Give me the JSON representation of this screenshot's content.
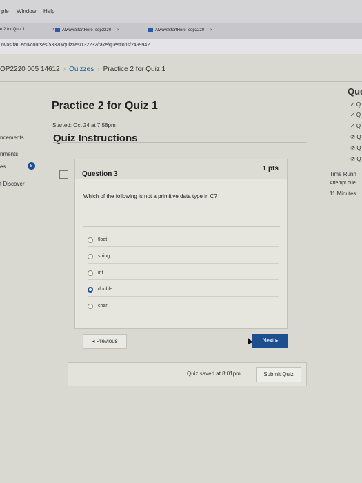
{
  "menubar": {
    "items": [
      "ple",
      "Window",
      "Help"
    ]
  },
  "tabs": [
    {
      "label": "e 2 for Quiz 1",
      "close": "×"
    },
    {
      "label": "AlwaysStartHere_cop2220 -",
      "close": "×"
    },
    {
      "label": "AlwaysStartHere_cop2220 -",
      "close": "×"
    }
  ],
  "url": "nvas.fau.edu/courses/53370/quizzes/132232/take/questions/2499942",
  "breadcrumb": {
    "course": "OP2220 005 14612",
    "quizzes": "Quizzes",
    "current": "Practice 2 for Quiz 1",
    "sep": "›"
  },
  "leftnav": {
    "items": [
      "ncements",
      "nments",
      "es",
      "t Discover"
    ],
    "badge": "8"
  },
  "quiz": {
    "title": "Practice 2 for Quiz 1",
    "started": "Started: Oct 24 at 7:58pm",
    "instructions_heading": "Quiz Instructions"
  },
  "question": {
    "number": "Question 3",
    "points": "1 pts",
    "text_before": "Which of the following is ",
    "text_underlined": "not a primitive data type",
    "text_after": " in C?",
    "answers": [
      {
        "label": "float",
        "selected": false
      },
      {
        "label": "string",
        "selected": false
      },
      {
        "label": "int",
        "selected": false
      },
      {
        "label": "double",
        "selected": true
      },
      {
        "label": "char",
        "selected": false
      }
    ]
  },
  "nav": {
    "previous": "◂ Previous",
    "next": "Next ▸"
  },
  "save": {
    "status": "Quiz saved at 8:01pm",
    "submit": "Submit Quiz"
  },
  "sidebar_right": {
    "heading": "Questi",
    "items": [
      "✓ Q",
      "✓ Q",
      "✓ Q",
      "⑦ Q",
      "⑦ Q",
      "⑦ Q"
    ]
  },
  "timer": {
    "label": "Time Runn",
    "attempt": "Attempt due:",
    "remaining": "11 Minutes"
  },
  "colors": {
    "accent": "#1d4e8f",
    "link": "#1a62a8"
  }
}
